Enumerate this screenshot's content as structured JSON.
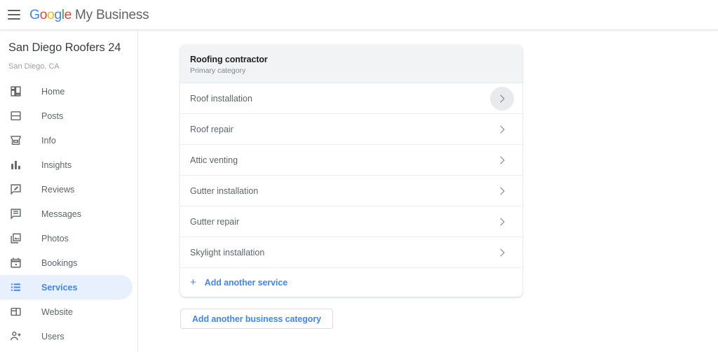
{
  "header": {
    "menu_icon": "hamburger-menu-icon",
    "logo_text": "Google",
    "product_name": "My Business"
  },
  "sidebar": {
    "business_name": "San Diego Roofers 24",
    "business_location": "San Diego, CA",
    "items": [
      {
        "label": "Home",
        "icon": "dashboard-icon",
        "active": false
      },
      {
        "label": "Posts",
        "icon": "posts-icon",
        "active": false
      },
      {
        "label": "Info",
        "icon": "storefront-icon",
        "active": false
      },
      {
        "label": "Insights",
        "icon": "bar-chart-icon",
        "active": false
      },
      {
        "label": "Reviews",
        "icon": "review-icon",
        "active": false
      },
      {
        "label": "Messages",
        "icon": "message-icon",
        "active": false
      },
      {
        "label": "Photos",
        "icon": "photos-icon",
        "active": false
      },
      {
        "label": "Bookings",
        "icon": "calendar-icon",
        "active": false
      },
      {
        "label": "Services",
        "icon": "list-icon",
        "active": true
      },
      {
        "label": "Website",
        "icon": "website-icon",
        "active": false
      },
      {
        "label": "Users",
        "icon": "person-add-icon",
        "active": false
      }
    ]
  },
  "main": {
    "category_card": {
      "category_name": "Roofing contractor",
      "category_subtitle": "Primary category",
      "services": [
        {
          "name": "Roof installation",
          "chevron_hovered": true
        },
        {
          "name": "Roof repair",
          "chevron_hovered": false
        },
        {
          "name": "Attic venting",
          "chevron_hovered": false
        },
        {
          "name": "Gutter installation",
          "chevron_hovered": false
        },
        {
          "name": "Gutter repair",
          "chevron_hovered": false
        },
        {
          "name": "Skylight installation",
          "chevron_hovered": false
        }
      ],
      "add_service_label": "Add another service",
      "add_service_icon": "plus-icon"
    },
    "add_category_label": "Add another business category"
  },
  "colors": {
    "accent_blue": "#4285f4",
    "active_pill_bg": "#e8f0fe",
    "card_header_bg": "#f1f3f4",
    "text_primary": "#202124",
    "text_secondary": "#5f6368",
    "text_muted": "#80868b"
  }
}
